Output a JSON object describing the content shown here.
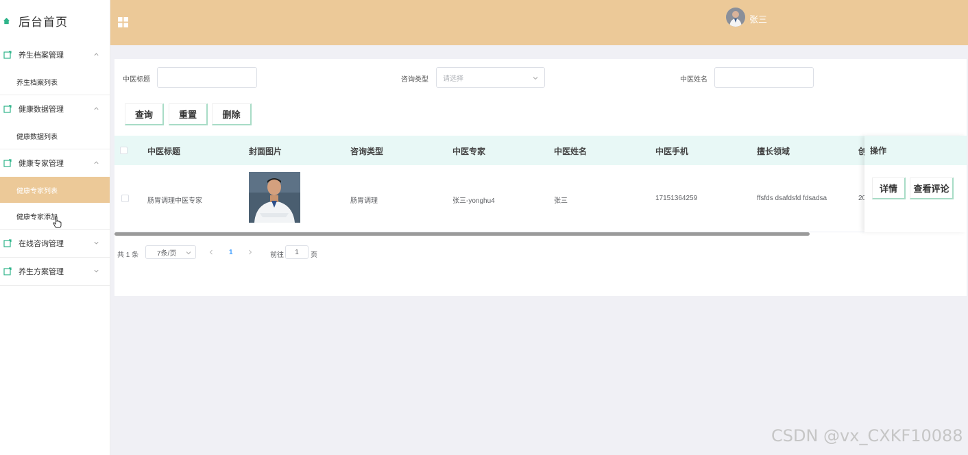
{
  "sidebar": {
    "brand": "后台首页",
    "groups": [
      {
        "label": "养生档案管理",
        "expanded": true,
        "items": [
          "养生档案列表"
        ]
      },
      {
        "label": "健康数据管理",
        "expanded": true,
        "items": [
          "健康数据列表"
        ]
      },
      {
        "label": "健康专家管理",
        "expanded": true,
        "items": [
          "健康专家列表",
          "健康专家添加"
        ],
        "active_item": "健康专家列表"
      },
      {
        "label": "在线咨询管理",
        "expanded": false,
        "items": []
      },
      {
        "label": "养生方案管理",
        "expanded": false,
        "items": []
      }
    ]
  },
  "header": {
    "username": "张三"
  },
  "search": {
    "title_label": "中医标题",
    "title_value": "",
    "type_label": "咨询类型",
    "type_placeholder": "请选择",
    "name_label": "中医姓名",
    "name_value": ""
  },
  "actions": {
    "query": "查询",
    "reset": "重置",
    "delete": "删除"
  },
  "table": {
    "columns": [
      "中医标题",
      "封面图片",
      "咨询类型",
      "中医专家",
      "中医姓名",
      "中医手机",
      "擅长领域",
      "创"
    ],
    "ops_header": "操作",
    "rows": [
      {
        "title": "肠胃调理中医专家",
        "type": "肠胃调理",
        "expert": "张三-yonghu4",
        "name": "张三",
        "phone": "17151364259",
        "field": "ffsfds dsafdsfd fdsadsa",
        "created": "20"
      }
    ],
    "row_actions": {
      "detail": "详情",
      "comments": "查看评论"
    }
  },
  "pagination": {
    "total_text": "共 1 条",
    "page_size": "7条/页",
    "current_page": "1",
    "goto_label": "前往",
    "goto_value": "1",
    "page_unit": "页"
  },
  "watermark": "CSDN @vx_CXKF10088",
  "colors": {
    "accent": "#ecc998",
    "table_header": "#e8f8f6",
    "menu_icon": "#2fb48a",
    "button_border": "#a8dcc6"
  }
}
